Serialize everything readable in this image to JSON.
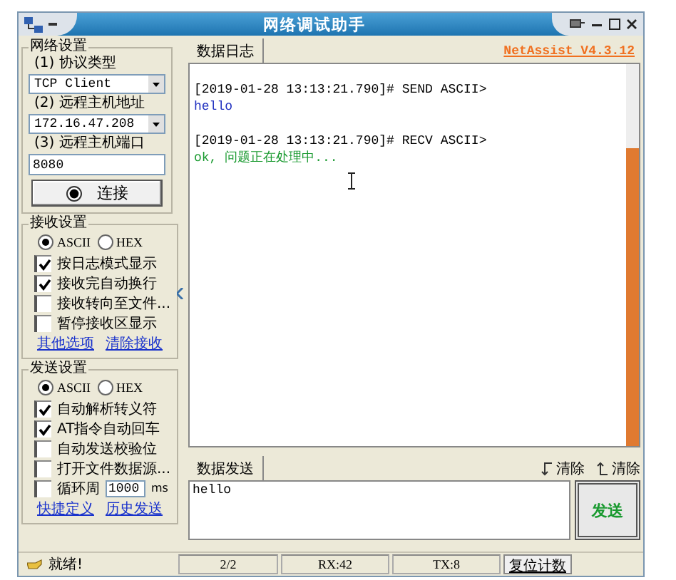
{
  "window": {
    "title": "网络调试助手"
  },
  "network_settings": {
    "title": "网络设置",
    "protocol_label": "(1) 协议类型",
    "protocol": "TCP Client",
    "host_label": "(2) 远程主机地址",
    "host": "172.16.47.208",
    "port_label": "(3) 远程主机端口",
    "port": "8080",
    "connect_button": "连接"
  },
  "receive_settings": {
    "title": "接收设置",
    "modes": [
      {
        "label": "ASCII",
        "selected": true
      },
      {
        "label": "HEX",
        "selected": false
      }
    ],
    "options": [
      {
        "kind": "checkbox",
        "label": "按日志模式显示",
        "checked": true
      },
      {
        "kind": "checkbox",
        "label": "接收完自动换行",
        "checked": true
      },
      {
        "kind": "checkbox",
        "label": "接收转向至文件...",
        "checked": false
      },
      {
        "kind": "checkbox",
        "label": "暂停接收区显示",
        "checked": false
      }
    ],
    "links": [
      "其他选项",
      "清除接收"
    ]
  },
  "send_settings": {
    "title": "发送设置",
    "modes": [
      {
        "label": "ASCII",
        "selected": true
      },
      {
        "label": "HEX",
        "selected": false
      }
    ],
    "options": [
      {
        "kind": "checkbox",
        "label": "自动解析转义符",
        "checked": true
      },
      {
        "kind": "checkbox",
        "label": "AT指令自动回车",
        "checked": true
      },
      {
        "kind": "checkbox",
        "label": "自动发送校验位",
        "checked": false
      },
      {
        "kind": "checkbox",
        "label": "打开文件数据源...",
        "checked": false
      },
      {
        "kind": "interval",
        "label": "循环周",
        "checked": false,
        "value": "1000",
        "unit": "ms"
      }
    ],
    "links": [
      "快捷定义",
      "历史发送"
    ]
  },
  "log": {
    "tab": "数据日志",
    "version": "NetAssist V4.3.12",
    "entries": [
      {
        "kind": "send",
        "header": "[2019-01-28 13:13:21.790]# SEND ASCII>",
        "body": "hello"
      },
      {
        "kind": "recv",
        "header": "[2019-01-28 13:13:21.790]# RECV ASCII>",
        "body": "ok, 问题正在处理中..."
      }
    ]
  },
  "send": {
    "tab": "数据发送",
    "clear_buttons": [
      "清除",
      "清除"
    ],
    "value": "hello",
    "send_button": "发送"
  },
  "status_bar": {
    "status": "就绪!",
    "count": "2/2",
    "rx": "RX:42",
    "tx": "TX:8",
    "reset_button": "复位计数"
  }
}
